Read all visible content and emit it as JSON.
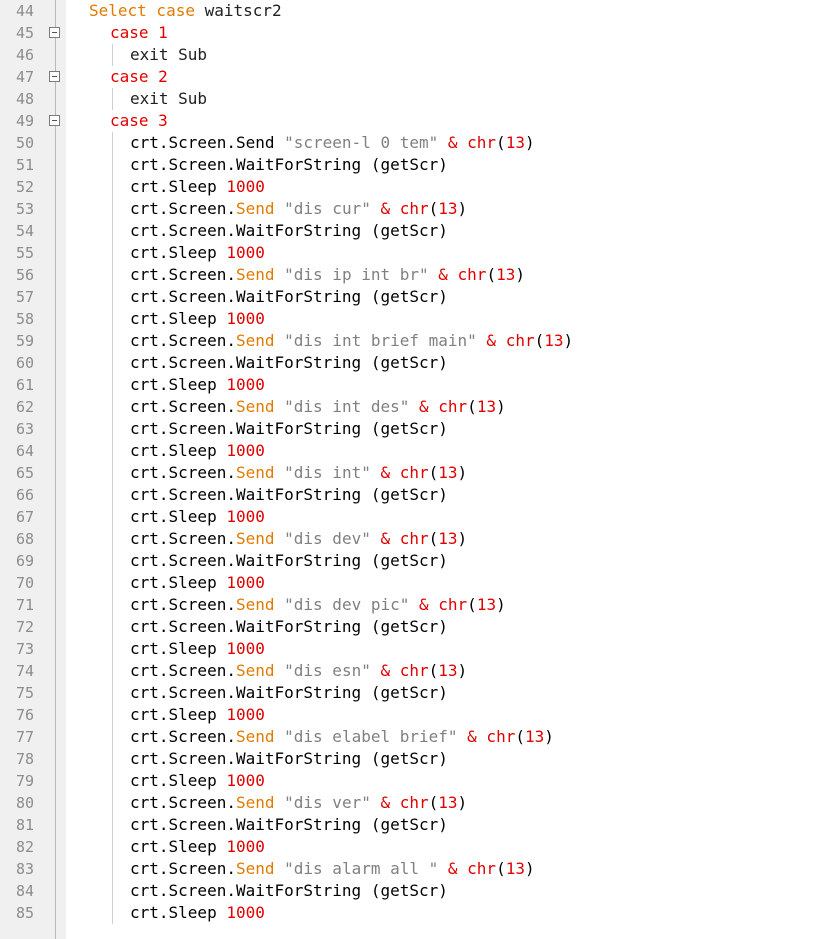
{
  "colors": {
    "keyword": "#e07b00",
    "number": "#e00000",
    "string": "#808080",
    "operator": "#e00000",
    "text": "#202020",
    "gutter_bg": "#f0f0f0",
    "line_number": "#8c8c8c"
  },
  "editor": {
    "lines": [
      {
        "n": "44",
        "l": 0,
        "fold": false,
        "guide": false,
        "t": [
          [
            "kw",
            "Select case "
          ],
          [
            "dark",
            "waitscr2"
          ]
        ]
      },
      {
        "n": "45",
        "l": 1,
        "fold": true,
        "guide": false,
        "t": [
          [
            "num",
            "case "
          ],
          [
            "num",
            "1"
          ]
        ]
      },
      {
        "n": "46",
        "l": 2,
        "fold": false,
        "guide": true,
        "t": [
          [
            "dark",
            "exit Sub"
          ]
        ]
      },
      {
        "n": "47",
        "l": 1,
        "fold": true,
        "guide": false,
        "t": [
          [
            "num",
            "case "
          ],
          [
            "num",
            "2"
          ]
        ]
      },
      {
        "n": "48",
        "l": 2,
        "fold": false,
        "guide": true,
        "t": [
          [
            "dark",
            "exit Sub"
          ]
        ]
      },
      {
        "n": "49",
        "l": 1,
        "fold": true,
        "guide": false,
        "t": [
          [
            "num",
            "case "
          ],
          [
            "num",
            "3"
          ]
        ]
      },
      {
        "n": "50",
        "l": 2,
        "fold": false,
        "guide": true,
        "t": [
          [
            "blk",
            "crt.Screen.Send "
          ],
          [
            "str",
            "\"screen-l 0 tem\""
          ],
          [
            "op",
            " & chr"
          ],
          [
            "blk",
            "("
          ],
          [
            "num",
            "13"
          ],
          [
            "blk",
            ")"
          ]
        ]
      },
      {
        "n": "51",
        "l": 2,
        "fold": false,
        "guide": true,
        "t": [
          [
            "blk",
            "crt.Screen.WaitForString (getScr)"
          ]
        ]
      },
      {
        "n": "52",
        "l": 2,
        "fold": false,
        "guide": true,
        "t": [
          [
            "blk",
            "crt.Sleep "
          ],
          [
            "num",
            "1000"
          ]
        ]
      },
      {
        "n": "53",
        "l": 2,
        "fold": false,
        "guide": true,
        "t": [
          [
            "blk",
            "crt.Screen."
          ],
          [
            "kw",
            "Send "
          ],
          [
            "str",
            "\"dis cur\""
          ],
          [
            "op",
            " & chr"
          ],
          [
            "blk",
            "("
          ],
          [
            "num",
            "13"
          ],
          [
            "blk",
            ")"
          ]
        ]
      },
      {
        "n": "54",
        "l": 2,
        "fold": false,
        "guide": true,
        "t": [
          [
            "blk",
            "crt.Screen.WaitForString (getScr)"
          ]
        ]
      },
      {
        "n": "55",
        "l": 2,
        "fold": false,
        "guide": true,
        "t": [
          [
            "blk",
            "crt.Sleep "
          ],
          [
            "num",
            "1000"
          ]
        ]
      },
      {
        "n": "56",
        "l": 2,
        "fold": false,
        "guide": true,
        "t": [
          [
            "blk",
            "crt.Screen."
          ],
          [
            "kw",
            "Send "
          ],
          [
            "str",
            "\"dis ip int br\""
          ],
          [
            "op",
            " & chr"
          ],
          [
            "blk",
            "("
          ],
          [
            "num",
            "13"
          ],
          [
            "blk",
            ")"
          ]
        ]
      },
      {
        "n": "57",
        "l": 2,
        "fold": false,
        "guide": true,
        "t": [
          [
            "blk",
            "crt.Screen.WaitForString (getScr)"
          ]
        ]
      },
      {
        "n": "58",
        "l": 2,
        "fold": false,
        "guide": true,
        "t": [
          [
            "blk",
            "crt.Sleep "
          ],
          [
            "num",
            "1000"
          ]
        ]
      },
      {
        "n": "59",
        "l": 2,
        "fold": false,
        "guide": true,
        "t": [
          [
            "blk",
            "crt.Screen."
          ],
          [
            "kw",
            "Send "
          ],
          [
            "str",
            "\"dis int brief main\""
          ],
          [
            "op",
            " & chr"
          ],
          [
            "blk",
            "("
          ],
          [
            "num",
            "13"
          ],
          [
            "blk",
            ")"
          ]
        ]
      },
      {
        "n": "60",
        "l": 2,
        "fold": false,
        "guide": true,
        "t": [
          [
            "blk",
            "crt.Screen.WaitForString (getScr)"
          ]
        ]
      },
      {
        "n": "61",
        "l": 2,
        "fold": false,
        "guide": true,
        "t": [
          [
            "blk",
            "crt.Sleep "
          ],
          [
            "num",
            "1000"
          ]
        ]
      },
      {
        "n": "62",
        "l": 2,
        "fold": false,
        "guide": true,
        "t": [
          [
            "blk",
            "crt.Screen."
          ],
          [
            "kw",
            "Send "
          ],
          [
            "str",
            "\"dis int des\""
          ],
          [
            "op",
            " & chr"
          ],
          [
            "blk",
            "("
          ],
          [
            "num",
            "13"
          ],
          [
            "blk",
            ")"
          ]
        ]
      },
      {
        "n": "63",
        "l": 2,
        "fold": false,
        "guide": true,
        "t": [
          [
            "blk",
            "crt.Screen.WaitForString (getScr)"
          ]
        ]
      },
      {
        "n": "64",
        "l": 2,
        "fold": false,
        "guide": true,
        "t": [
          [
            "blk",
            "crt.Sleep "
          ],
          [
            "num",
            "1000"
          ]
        ]
      },
      {
        "n": "65",
        "l": 2,
        "fold": false,
        "guide": true,
        "t": [
          [
            "blk",
            "crt.Screen."
          ],
          [
            "kw",
            "Send "
          ],
          [
            "str",
            "\"dis int\""
          ],
          [
            "op",
            " & chr"
          ],
          [
            "blk",
            "("
          ],
          [
            "num",
            "13"
          ],
          [
            "blk",
            ")"
          ]
        ]
      },
      {
        "n": "66",
        "l": 2,
        "fold": false,
        "guide": true,
        "t": [
          [
            "blk",
            "crt.Screen.WaitForString (getScr)"
          ]
        ]
      },
      {
        "n": "67",
        "l": 2,
        "fold": false,
        "guide": true,
        "t": [
          [
            "blk",
            "crt.Sleep "
          ],
          [
            "num",
            "1000"
          ]
        ]
      },
      {
        "n": "68",
        "l": 2,
        "fold": false,
        "guide": true,
        "t": [
          [
            "blk",
            "crt.Screen."
          ],
          [
            "kw",
            "Send "
          ],
          [
            "str",
            "\"dis dev\""
          ],
          [
            "op",
            " & chr"
          ],
          [
            "blk",
            "("
          ],
          [
            "num",
            "13"
          ],
          [
            "blk",
            ")"
          ]
        ]
      },
      {
        "n": "69",
        "l": 2,
        "fold": false,
        "guide": true,
        "t": [
          [
            "blk",
            "crt.Screen.WaitForString (getScr)"
          ]
        ]
      },
      {
        "n": "70",
        "l": 2,
        "fold": false,
        "guide": true,
        "t": [
          [
            "blk",
            "crt.Sleep "
          ],
          [
            "num",
            "1000"
          ]
        ]
      },
      {
        "n": "71",
        "l": 2,
        "fold": false,
        "guide": true,
        "t": [
          [
            "blk",
            "crt.Screen."
          ],
          [
            "kw",
            "Send "
          ],
          [
            "str",
            "\"dis dev pic\""
          ],
          [
            "op",
            " & chr"
          ],
          [
            "blk",
            "("
          ],
          [
            "num",
            "13"
          ],
          [
            "blk",
            ")"
          ]
        ]
      },
      {
        "n": "72",
        "l": 2,
        "fold": false,
        "guide": true,
        "t": [
          [
            "blk",
            "crt.Screen.WaitForString (getScr)"
          ]
        ]
      },
      {
        "n": "73",
        "l": 2,
        "fold": false,
        "guide": true,
        "t": [
          [
            "blk",
            "crt.Sleep "
          ],
          [
            "num",
            "1000"
          ]
        ]
      },
      {
        "n": "74",
        "l": 2,
        "fold": false,
        "guide": true,
        "t": [
          [
            "blk",
            "crt.Screen."
          ],
          [
            "kw",
            "Send "
          ],
          [
            "str",
            "\"dis esn\""
          ],
          [
            "op",
            " & chr"
          ],
          [
            "blk",
            "("
          ],
          [
            "num",
            "13"
          ],
          [
            "blk",
            ")"
          ]
        ]
      },
      {
        "n": "75",
        "l": 2,
        "fold": false,
        "guide": true,
        "t": [
          [
            "blk",
            "crt.Screen.WaitForString (getScr)"
          ]
        ]
      },
      {
        "n": "76",
        "l": 2,
        "fold": false,
        "guide": true,
        "t": [
          [
            "blk",
            "crt.Sleep "
          ],
          [
            "num",
            "1000"
          ]
        ]
      },
      {
        "n": "77",
        "l": 2,
        "fold": false,
        "guide": true,
        "t": [
          [
            "blk",
            "crt.Screen."
          ],
          [
            "kw",
            "Send "
          ],
          [
            "str",
            "\"dis elabel brief\""
          ],
          [
            "op",
            " & chr"
          ],
          [
            "blk",
            "("
          ],
          [
            "num",
            "13"
          ],
          [
            "blk",
            ")"
          ]
        ]
      },
      {
        "n": "78",
        "l": 2,
        "fold": false,
        "guide": true,
        "t": [
          [
            "blk",
            "crt.Screen.WaitForString (getScr)"
          ]
        ]
      },
      {
        "n": "79",
        "l": 2,
        "fold": false,
        "guide": true,
        "t": [
          [
            "blk",
            "crt.Sleep "
          ],
          [
            "num",
            "1000"
          ]
        ]
      },
      {
        "n": "80",
        "l": 2,
        "fold": false,
        "guide": true,
        "t": [
          [
            "blk",
            "crt.Screen."
          ],
          [
            "kw",
            "Send "
          ],
          [
            "str",
            "\"dis ver\""
          ],
          [
            "op",
            " & chr"
          ],
          [
            "blk",
            "("
          ],
          [
            "num",
            "13"
          ],
          [
            "blk",
            ")"
          ]
        ]
      },
      {
        "n": "81",
        "l": 2,
        "fold": false,
        "guide": true,
        "t": [
          [
            "blk",
            "crt.Screen.WaitForString (getScr)"
          ]
        ]
      },
      {
        "n": "82",
        "l": 2,
        "fold": false,
        "guide": true,
        "t": [
          [
            "blk",
            "crt.Sleep "
          ],
          [
            "num",
            "1000"
          ]
        ]
      },
      {
        "n": "83",
        "l": 2,
        "fold": false,
        "guide": true,
        "t": [
          [
            "blk",
            "crt.Screen."
          ],
          [
            "kw",
            "Send "
          ],
          [
            "str",
            "\"dis alarm all \""
          ],
          [
            "op",
            " & chr"
          ],
          [
            "blk",
            "("
          ],
          [
            "num",
            "13"
          ],
          [
            "blk",
            ")"
          ]
        ]
      },
      {
        "n": "84",
        "l": 2,
        "fold": false,
        "guide": true,
        "t": [
          [
            "blk",
            "crt.Screen.WaitForString (getScr)"
          ]
        ]
      },
      {
        "n": "85",
        "l": 2,
        "fold": false,
        "guide": true,
        "t": [
          [
            "blk",
            "crt.Sleep "
          ],
          [
            "num",
            "1000"
          ]
        ]
      }
    ]
  }
}
